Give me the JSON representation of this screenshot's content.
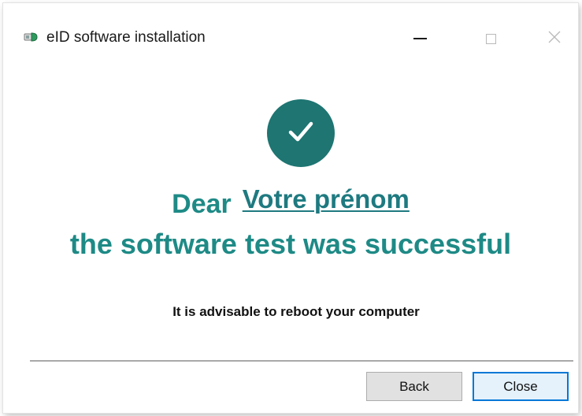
{
  "window": {
    "title": "eID software installation",
    "icons": {
      "app": "eid-card-reader-icon",
      "minimize": "minimize-icon",
      "maximize": "maximize-icon",
      "close": "close-icon"
    }
  },
  "content": {
    "success_icon": "check-icon",
    "greeting_prefix": "Dear",
    "name_placeholder": "Votre prénom",
    "success_message": "the software test was successful",
    "advice": "It is advisable to reboot your computer"
  },
  "buttons": {
    "back_label": "Back",
    "close_label": "Close"
  },
  "colors": {
    "accent": "#1e8a86",
    "circle": "#1e7572",
    "name_link": "#1e7a80",
    "focus_border": "#0078d7"
  }
}
